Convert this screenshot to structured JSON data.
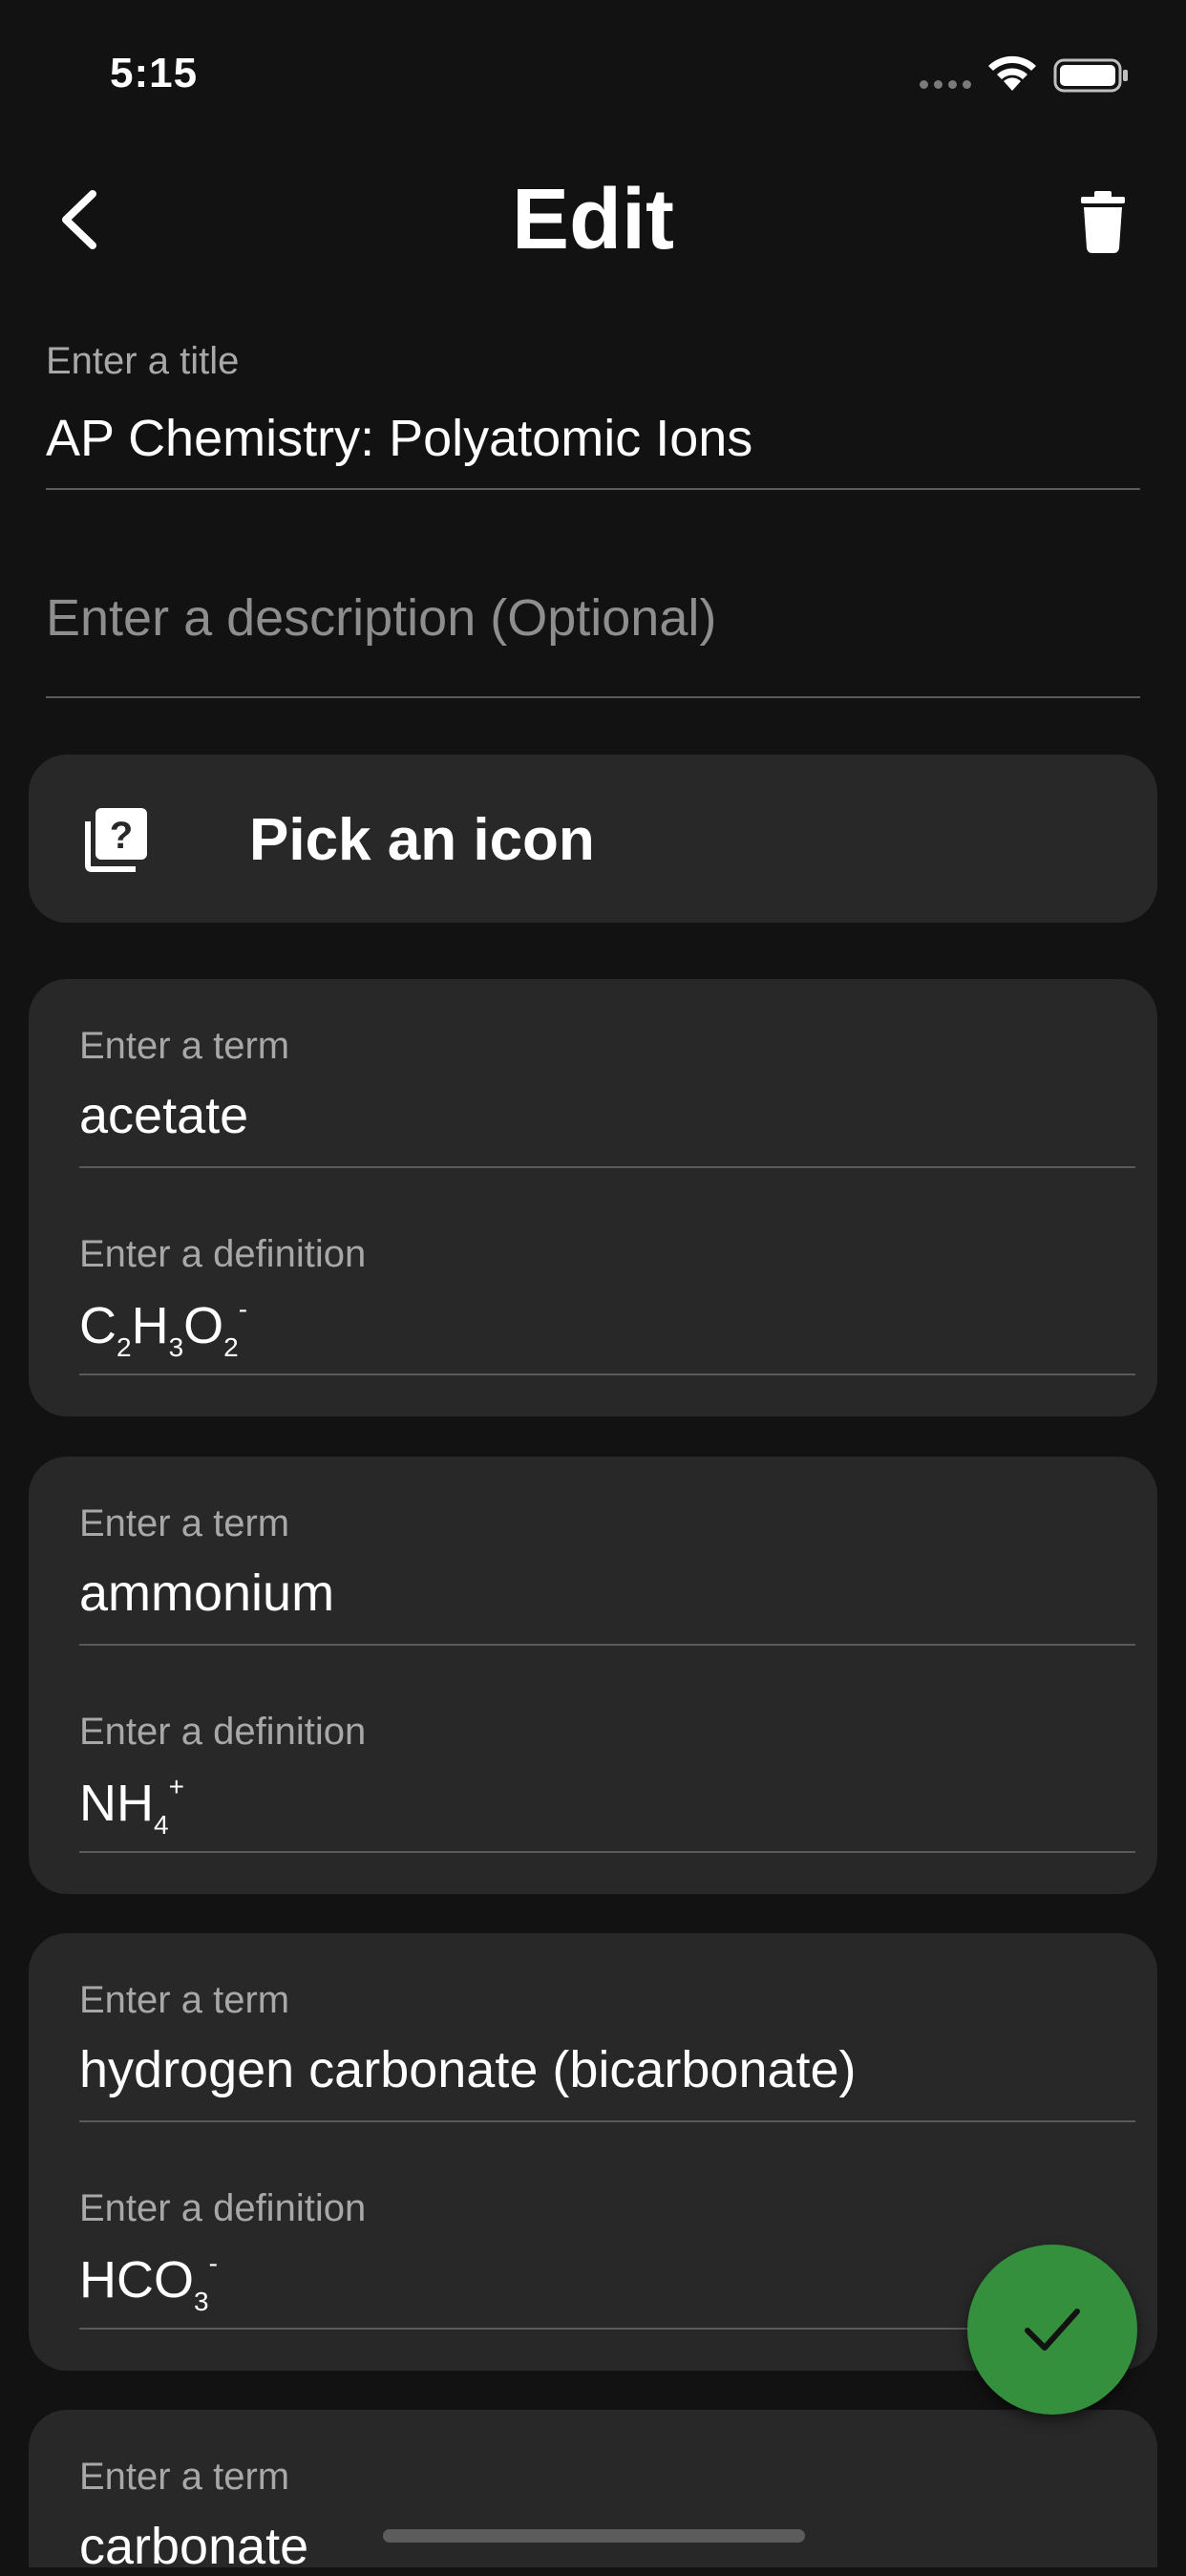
{
  "status_bar": {
    "time": "5:15"
  },
  "header": {
    "title": "Edit"
  },
  "title_field": {
    "label": "Enter a title",
    "value": "AP Chemistry: Polyatomic Ions"
  },
  "description_field": {
    "placeholder": "Enter a description (Optional)",
    "value": ""
  },
  "pick_icon": {
    "label": "Pick an icon"
  },
  "cards": [
    {
      "term_label": "Enter a term",
      "term": "acetate",
      "definition_label": "Enter a definition",
      "definition": {
        "p1": "C",
        "s1": "2",
        "p2": "H",
        "s2": "3",
        "p3": "O",
        "s3": "2",
        "charge": "-"
      }
    },
    {
      "term_label": "Enter a term",
      "term": "ammonium",
      "definition_label": "Enter a definition",
      "definition": {
        "p1": "NH",
        "s1": "4",
        "charge": "+"
      }
    },
    {
      "term_label": "Enter a term",
      "term": "hydrogen carbonate (bicarbonate)",
      "definition_label": "Enter a definition",
      "definition": {
        "p1": "HCO",
        "s1": "3",
        "charge": "-"
      }
    },
    {
      "term_label": "Enter a term",
      "term": "carbonate"
    }
  ],
  "icons": {
    "back": "chevron-left-icon",
    "delete": "trash-icon",
    "pick": "help-library-icon",
    "save": "checkmark-icon"
  },
  "colors": {
    "background": "#121212",
    "card": "#282828",
    "fab": "#35903d",
    "text": "#ffffff",
    "muted_text": "#a8a8a8"
  }
}
